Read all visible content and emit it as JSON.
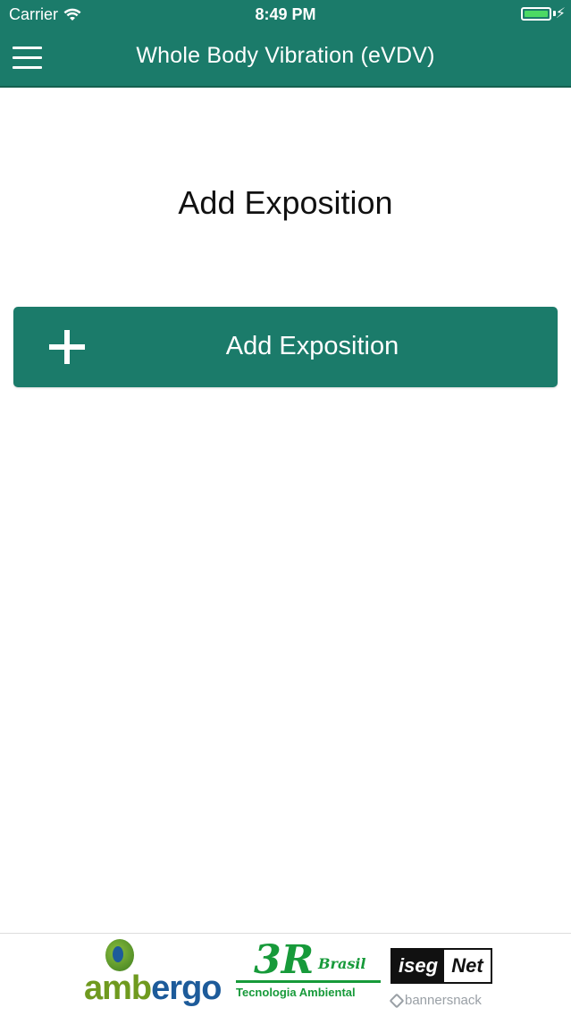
{
  "status_bar": {
    "carrier": "Carrier",
    "time": "8:49 PM",
    "battery_level": 100,
    "battery_color": "#4cd964",
    "icons": [
      "wifi-icon",
      "battery-icon",
      "charging-bolt-icon"
    ]
  },
  "header": {
    "title": "Whole Body Vibration (eVDV)",
    "menu_icon": "hamburger-menu-icon",
    "background_color": "#1b7b6a"
  },
  "main": {
    "title": "Add Exposition",
    "add_button": {
      "label": "Add Exposition",
      "icon": "plus-icon",
      "background_color": "#1b7b6a"
    }
  },
  "footer": {
    "logos": {
      "ambergo_left": "amb",
      "ambergo_mid": "e",
      "ambergo_right": "rgo",
      "three_r_big": "3R",
      "three_r_brasil": "Brasil",
      "three_r_tagline": "Tecnologia Ambiental",
      "iseg_left": "iseg",
      "iseg_right": "Net"
    },
    "banner_credit": "bannersnack"
  }
}
